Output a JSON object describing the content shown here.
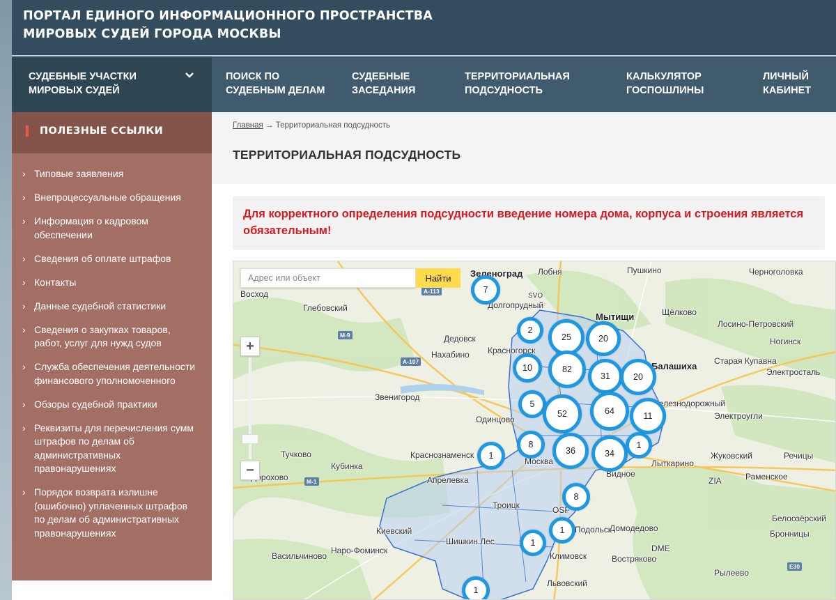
{
  "header": {
    "title": "Портал единого информационного пространства мировых судей города Москвы"
  },
  "nav": {
    "first": "Судебные участки мировых судей",
    "items": [
      "Поиск по судебным делам",
      "Судебные заседания",
      "Территориальная подсудность",
      "Калькулятор госпошлины",
      "Личный кабинет"
    ]
  },
  "sidebar": {
    "heading": "Полезные ссылки",
    "items": [
      "Типовые заявления",
      "Внепроцессуальные обращения",
      "Информация о кадровом обеспечении",
      "Сведения об оплате штрафов",
      "Контакты",
      "Данные судебной статистики",
      "Сведения о закупках товаров, работ, услуг для нужд судов",
      "Служба обеспечения деятельности финансового уполномоченного",
      "Обзоры судебной практики",
      "Реквизиты для перечисления сумм штрафов по делам об административных правонарушениях",
      "Порядок возврата излишне (ошибочно) уплаченных штрафов по делам об административных правонарушениях"
    ]
  },
  "breadcrumb": {
    "home": "Главная",
    "separator": "→",
    "current": "Территориальная подсудность"
  },
  "page_title": "Территориальная подсудность",
  "notice": "Для корректного определения подсудности введение номера дома, корпуса и строения является обязательным!",
  "map": {
    "search_placeholder": "Адрес или объект",
    "find_label": "Найти",
    "zoom_in": "+",
    "zoom_out": "−",
    "labels": [
      "Зеленоград",
      "Лобня",
      "Пушкино",
      "Черноголовка",
      "Восход",
      "SVO",
      "Долгопрудный",
      "Глебовский",
      "Мытищи",
      "Щёлково",
      "Лосино-Петровский",
      "Дедовск",
      "Ногинск",
      "Нахабино",
      "Красногорск",
      "Балашиха",
      "Старая Купавна",
      "Электросталь",
      "Звенигород",
      "Железнодорожный",
      "Одинцово",
      "Электроугли",
      "Тучково",
      "Краснознаменск",
      "Кубинка",
      "Москва",
      "Лыткарино",
      "Жуковский",
      "Речицы",
      "Дорохово",
      "Апрелевка",
      "Видное",
      "ZIA",
      "Раменское",
      "Троицк",
      "Домодедово",
      "Белоозёрский",
      "Киевский",
      "Шишкин Лес",
      "Бронницы",
      "Наро-Фоминск",
      "DME",
      "Климовск",
      "Васильчиново",
      "Востряково",
      "Подольск",
      "Львовский",
      "Рылеево",
      "OSF",
      "М-9",
      "А-107",
      "А-113",
      "М-1",
      "E30"
    ],
    "clusters": [
      7,
      2,
      25,
      20,
      10,
      82,
      31,
      20,
      5,
      52,
      64,
      11,
      8,
      36,
      34,
      1,
      1,
      8,
      1,
      1,
      1
    ]
  },
  "colors": {
    "header_bg": "#344d5e",
    "nav_bg": "#3f5b6d",
    "sidebar_bg": "#a36f64",
    "notice_text": "#d71920",
    "cluster_ring": "#1e98e0",
    "find_button": "#ffdb4d"
  }
}
